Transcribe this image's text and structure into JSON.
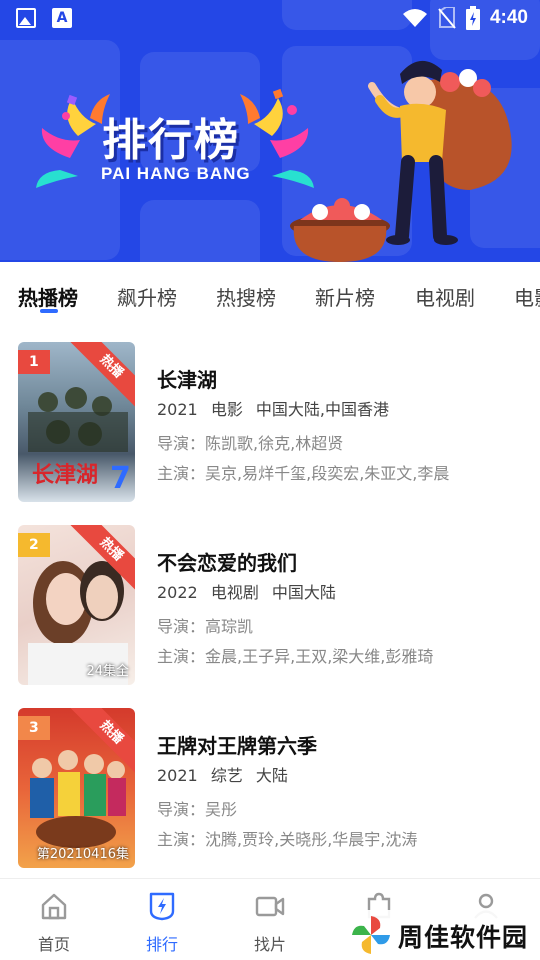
{
  "status_bar": {
    "time": "4:40",
    "icons": [
      "image-icon",
      "a-icon",
      "wifi-icon",
      "no-sim-icon",
      "battery-icon"
    ]
  },
  "banner": {
    "title": "排行榜",
    "subtitle": "PAI HANG BANG",
    "background_color": "#2447e6"
  },
  "tabs": [
    {
      "label": "热播榜",
      "active": true
    },
    {
      "label": "飙升榜",
      "active": false
    },
    {
      "label": "热搜榜",
      "active": false
    },
    {
      "label": "新片榜",
      "active": false
    },
    {
      "label": "电视剧",
      "active": false
    },
    {
      "label": "电影",
      "active": false
    }
  ],
  "list": [
    {
      "rank": "1",
      "badge": "热播",
      "title": "长津湖",
      "year": "2021",
      "category": "电影",
      "region": "中国大陆,中国香港",
      "director_label": "导演：",
      "director": "陈凯歌,徐克,林超贤",
      "cast_label": "主演：",
      "cast": "吴京,易烊千玺,段奕宏,朱亚文,李晨",
      "episode": "",
      "rank_color": "#e8493f"
    },
    {
      "rank": "2",
      "badge": "热播",
      "title": "不会恋爱的我们",
      "year": "2022",
      "category": "电视剧",
      "region": "中国大陆",
      "director_label": "导演：",
      "director": "高琮凯",
      "cast_label": "主演：",
      "cast": "金晨,王子异,王双,梁大维,彭雅琦",
      "episode": "24集全",
      "rank_color": "#f5b92e"
    },
    {
      "rank": "3",
      "badge": "热播",
      "title": "王牌对王牌第六季",
      "year": "2021",
      "category": "综艺",
      "region": "大陆",
      "director_label": "导演：",
      "director": "吴彤",
      "cast_label": "主演：",
      "cast": "沈腾,贾玲,关晓彤,华晨宇,沈涛",
      "episode": "第20210416集",
      "rank_color": "#f2874a"
    }
  ],
  "bottom_nav": [
    {
      "label": "首页",
      "icon": "home-icon",
      "active": false
    },
    {
      "label": "排行",
      "icon": "ranking-icon",
      "active": true
    },
    {
      "label": "找片",
      "icon": "video-camera-icon",
      "active": false
    },
    {
      "label": "",
      "icon": "puzzle-icon",
      "active": false
    },
    {
      "label": "",
      "icon": "profile-icon",
      "active": false
    }
  ],
  "watermark": {
    "text": "周佳软件园"
  },
  "colors": {
    "accent": "#2f6bff",
    "hot": "#e8493f"
  }
}
